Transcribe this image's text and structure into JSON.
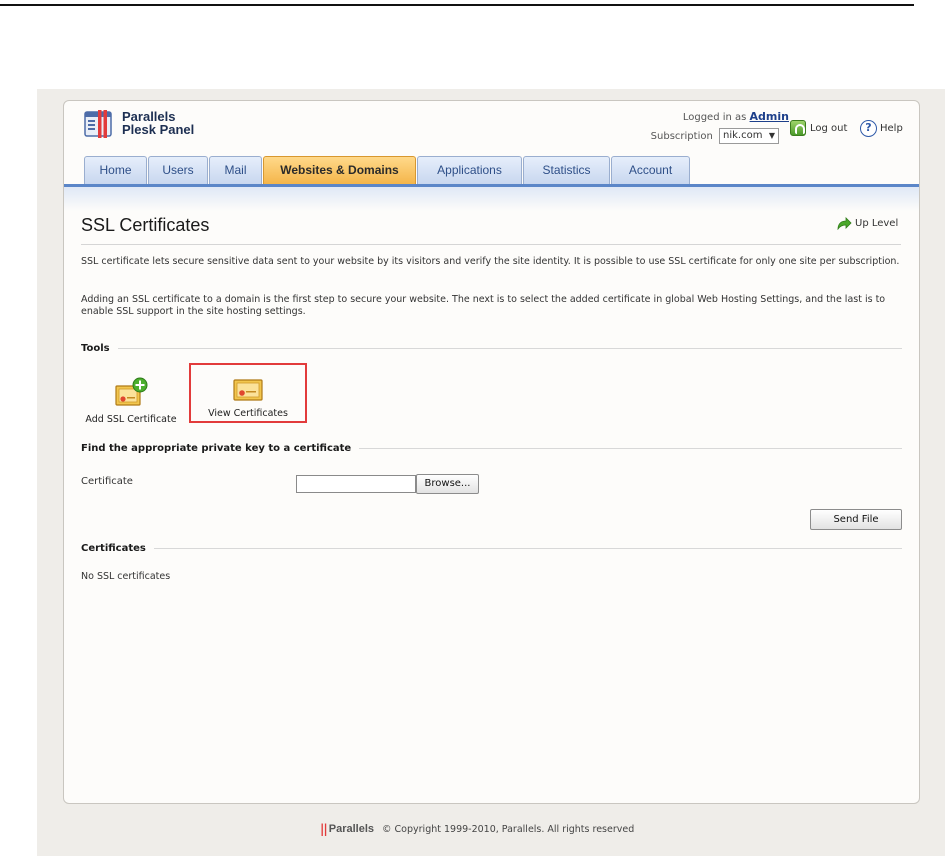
{
  "header": {
    "logo_line1": "Parallels",
    "logo_line2": "Plesk Panel",
    "logged_in_prefix": "Logged in as",
    "logged_in_user": "Admin",
    "subscription_label": "Subscription",
    "subscription_value": "nik.com",
    "logout_label": "Log out",
    "help_label": "Help"
  },
  "tabs": [
    {
      "label": "Home",
      "active": false
    },
    {
      "label": "Users",
      "active": false
    },
    {
      "label": "Mail",
      "active": false
    },
    {
      "label": "Websites & Domains",
      "active": true
    },
    {
      "label": "Applications",
      "active": false
    },
    {
      "label": "Statistics",
      "active": false
    },
    {
      "label": "Account",
      "active": false
    }
  ],
  "page": {
    "title": "SSL Certificates",
    "up_level": "Up Level",
    "intro1": "SSL certificate lets secure sensitive data sent to your website by its visitors and verify the site identity. It is possible to use SSL certificate for only one site per subscription.",
    "intro2": "Adding an SSL certificate to a domain is the first step to secure your website. The next is to select the added certificate in global Web Hosting Settings, and the last is to enable SSL support in the site hosting settings."
  },
  "tools": {
    "heading": "Tools",
    "add_label": "Add SSL Certificate",
    "view_label": "View Certificates"
  },
  "find_key": {
    "heading": "Find the appropriate private key to a certificate",
    "certificate_label": "Certificate",
    "file_value": "",
    "browse_label": "Browse...",
    "send_label": "Send File"
  },
  "certificates": {
    "heading": "Certificates",
    "empty_text": "No SSL certificates"
  },
  "footer": {
    "brand": "Parallels",
    "copyright": "© Copyright 1999-2010, Parallels. All rights reserved"
  },
  "colors": {
    "tab_active": "#f4b54a",
    "tab_bar": "#5b86c8",
    "highlight_border": "#e23b3b"
  }
}
